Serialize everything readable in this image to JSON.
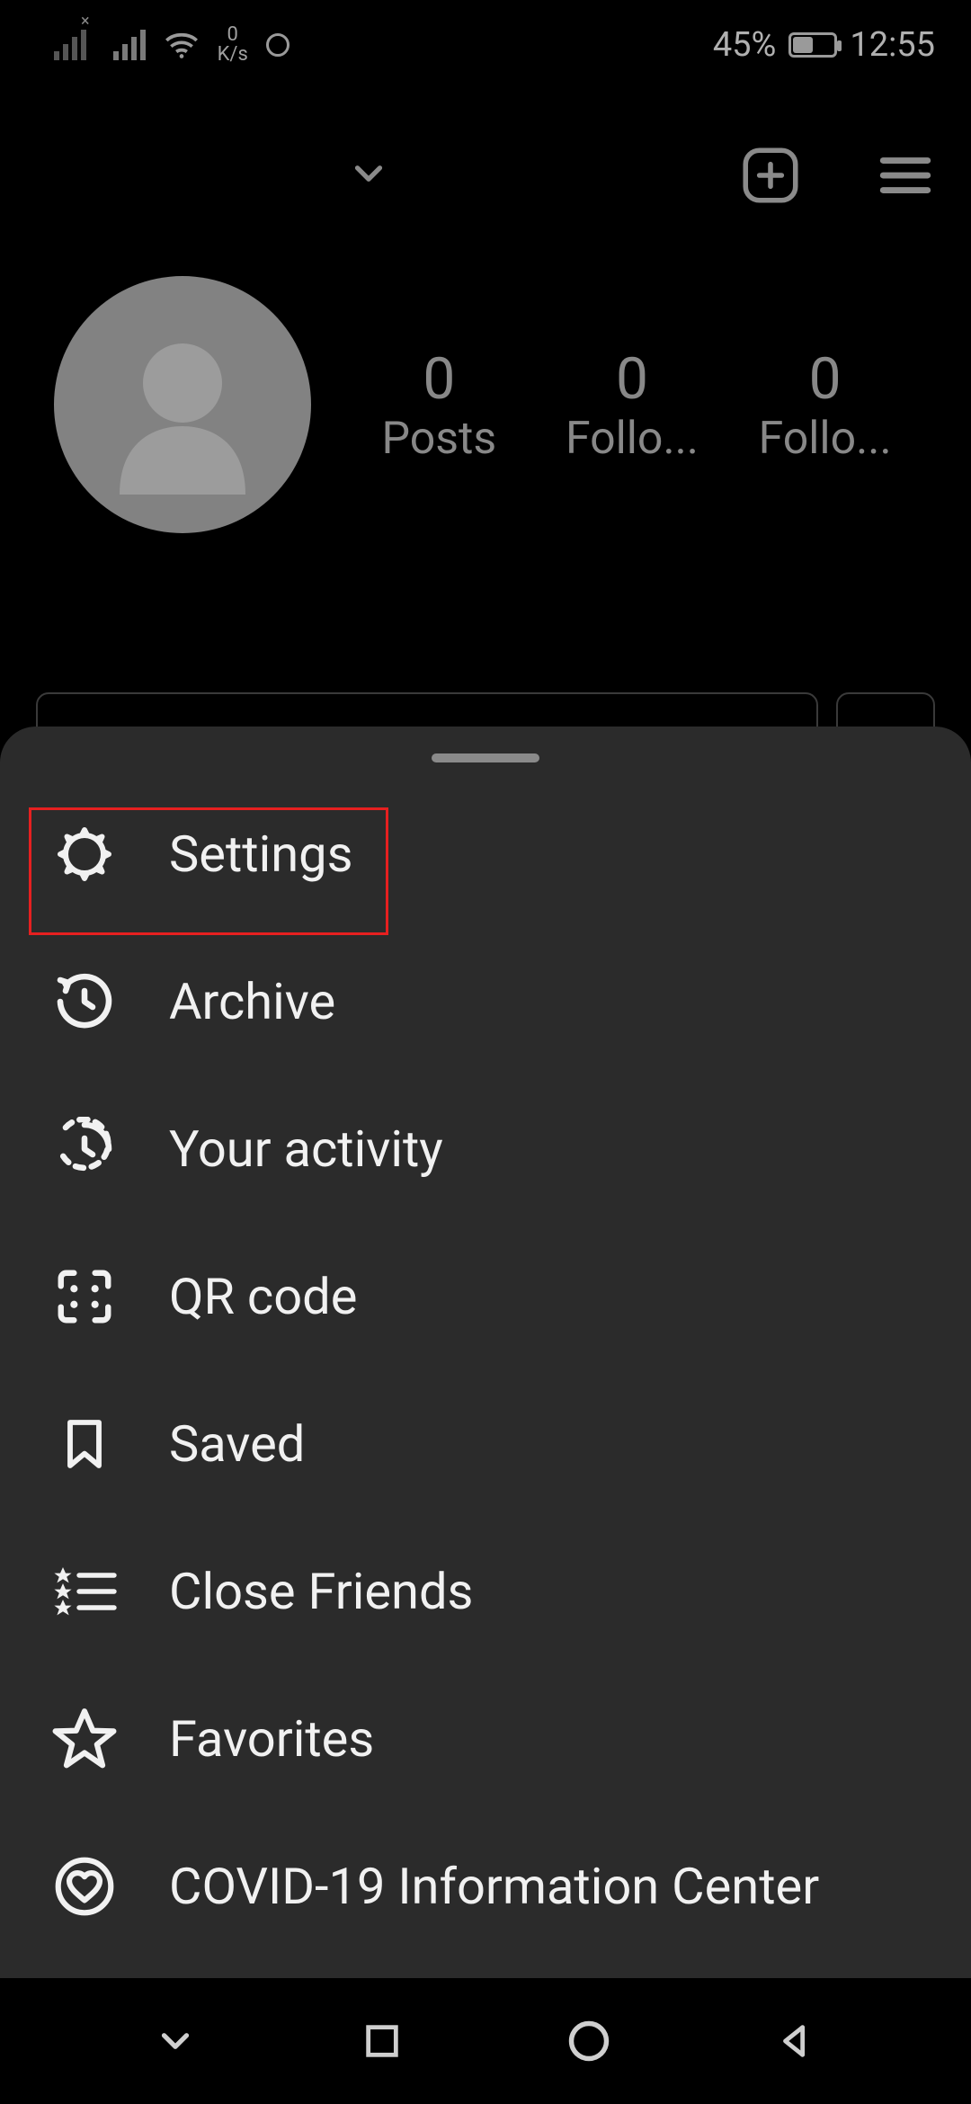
{
  "status": {
    "data_rate_top": "0",
    "data_rate_unit": "K/s",
    "battery_percent": "45%",
    "time": "12:55"
  },
  "profile": {
    "stats": [
      {
        "count": "0",
        "label": "Posts"
      },
      {
        "count": "0",
        "label": "Follo..."
      },
      {
        "count": "0",
        "label": "Follo..."
      }
    ]
  },
  "menu": {
    "items": [
      {
        "label": "Settings"
      },
      {
        "label": "Archive"
      },
      {
        "label": "Your activity"
      },
      {
        "label": "QR code"
      },
      {
        "label": "Saved"
      },
      {
        "label": "Close Friends"
      },
      {
        "label": "Favorites"
      },
      {
        "label": "COVID-19 Information Center"
      }
    ]
  },
  "highlight": {
    "target": "menu-item-settings"
  },
  "colors": {
    "sheet_bg": "#2b2b2b",
    "highlight_border": "#e62020",
    "text_primary": "#f1f1f1",
    "text_dim": "#888888"
  }
}
